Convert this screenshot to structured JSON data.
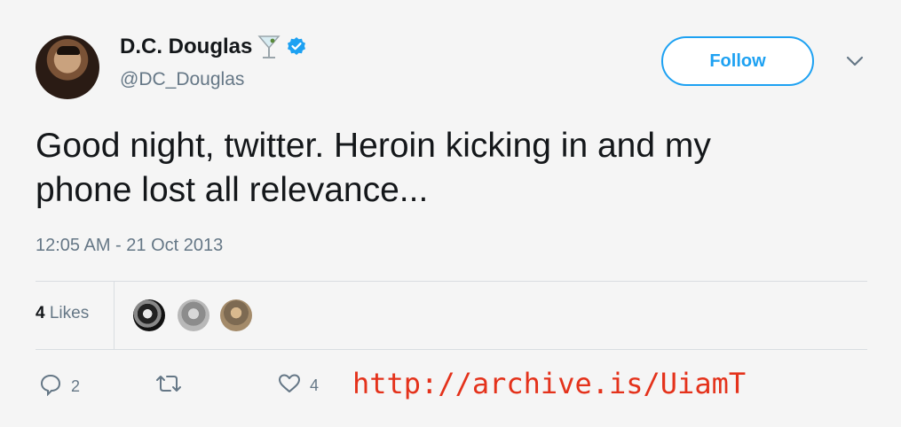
{
  "tweet": {
    "author": {
      "name": "D.C. Douglas",
      "handle": "@DC_Douglas",
      "name_emoji_icon": "martini-icon",
      "verified_icon": "verified-icon"
    },
    "follow_label": "Follow",
    "menu_icon": "chevron-down-icon",
    "text": "Good night, twitter.  Heroin kicking in and my\nphone lost all relevance...",
    "timestamp": "12:05 AM - 21 Oct 2013",
    "likes": {
      "count": "4",
      "label": "Likes"
    },
    "actions": {
      "reply_count": "2",
      "retweet_count": "",
      "like_count": "4"
    }
  },
  "annotation": {
    "link_text": "http://archive.is/UiamT"
  },
  "colors": {
    "accent": "#1da1f2",
    "secondary_text": "#657786",
    "link_red": "#e4321b",
    "background": "#f5f5f5"
  }
}
